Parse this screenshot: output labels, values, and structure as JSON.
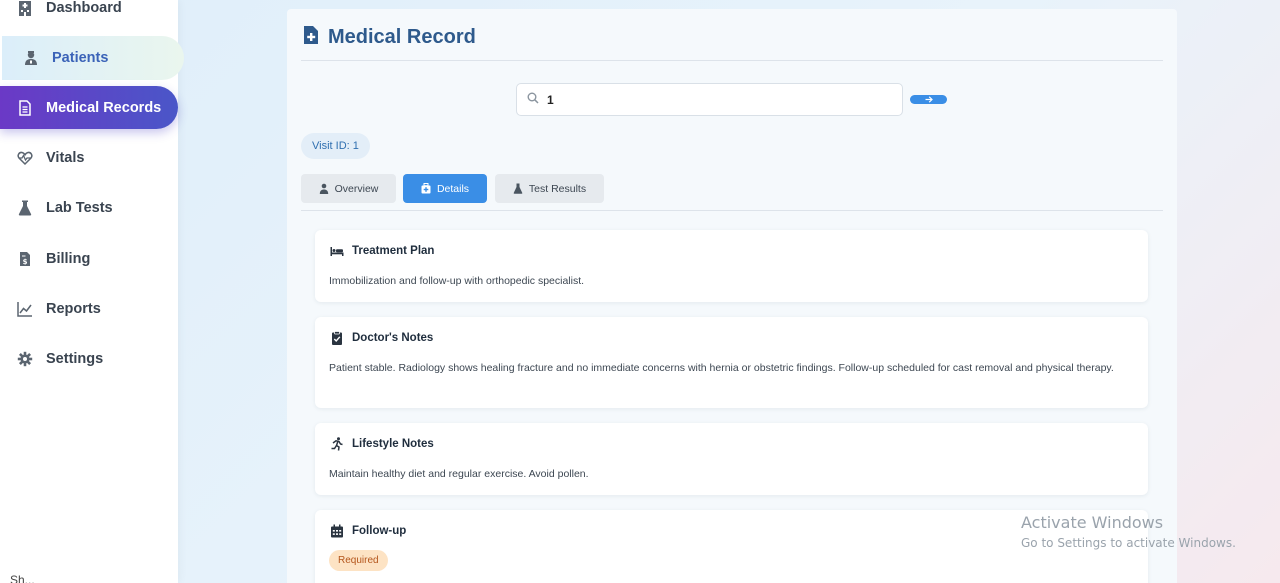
{
  "sidebar": {
    "items": [
      {
        "label": "Dashboard",
        "icon": "hospital-icon"
      },
      {
        "label": "Patients",
        "icon": "user-nurse-icon"
      },
      {
        "label": "Medical Records",
        "icon": "file-lines-icon"
      },
      {
        "label": "Vitals",
        "icon": "heart-pulse-icon"
      },
      {
        "label": "Lab Tests",
        "icon": "flask-icon"
      },
      {
        "label": "Billing",
        "icon": "file-invoice-dollar-icon"
      },
      {
        "label": "Reports",
        "icon": "chart-line-icon"
      },
      {
        "label": "Settings",
        "icon": "gear-icon"
      }
    ],
    "active": "Medical Records",
    "bottom_text": "Sh..."
  },
  "main": {
    "title": "Medical Record",
    "search": {
      "value": "1"
    },
    "visit_badge": "Visit ID: 1",
    "tabs": [
      {
        "label": "Overview",
        "active": false
      },
      {
        "label": "Details",
        "active": true
      },
      {
        "label": "Test Results",
        "active": false
      }
    ],
    "cards": [
      {
        "title": "Treatment Plan",
        "icon": "bed-icon",
        "body": "Immobilization and follow-up with orthopedic specialist."
      },
      {
        "title": "Doctor's Notes",
        "icon": "clipboard-check-icon",
        "body": "Patient stable. Radiology shows healing fracture and no immediate concerns with hernia or obstetric findings. Follow-up scheduled for cast removal and physical therapy."
      },
      {
        "title": "Lifestyle Notes",
        "icon": "person-running-icon",
        "body": "Maintain healthy diet and regular exercise. Avoid pollen."
      },
      {
        "title": "Follow-up",
        "icon": "calendar-icon",
        "status": "Required"
      }
    ]
  },
  "watermark": {
    "line1": "Activate Windows",
    "line2": "Go to Settings to activate Windows."
  },
  "colors": {
    "accent": "#3a8ee6",
    "title": "#2e5a8c",
    "active_nav_start": "#6b39c6",
    "active_nav_end": "#4a56c8",
    "pill_bg": "#fde3c4",
    "pill_text": "#b4561c"
  }
}
